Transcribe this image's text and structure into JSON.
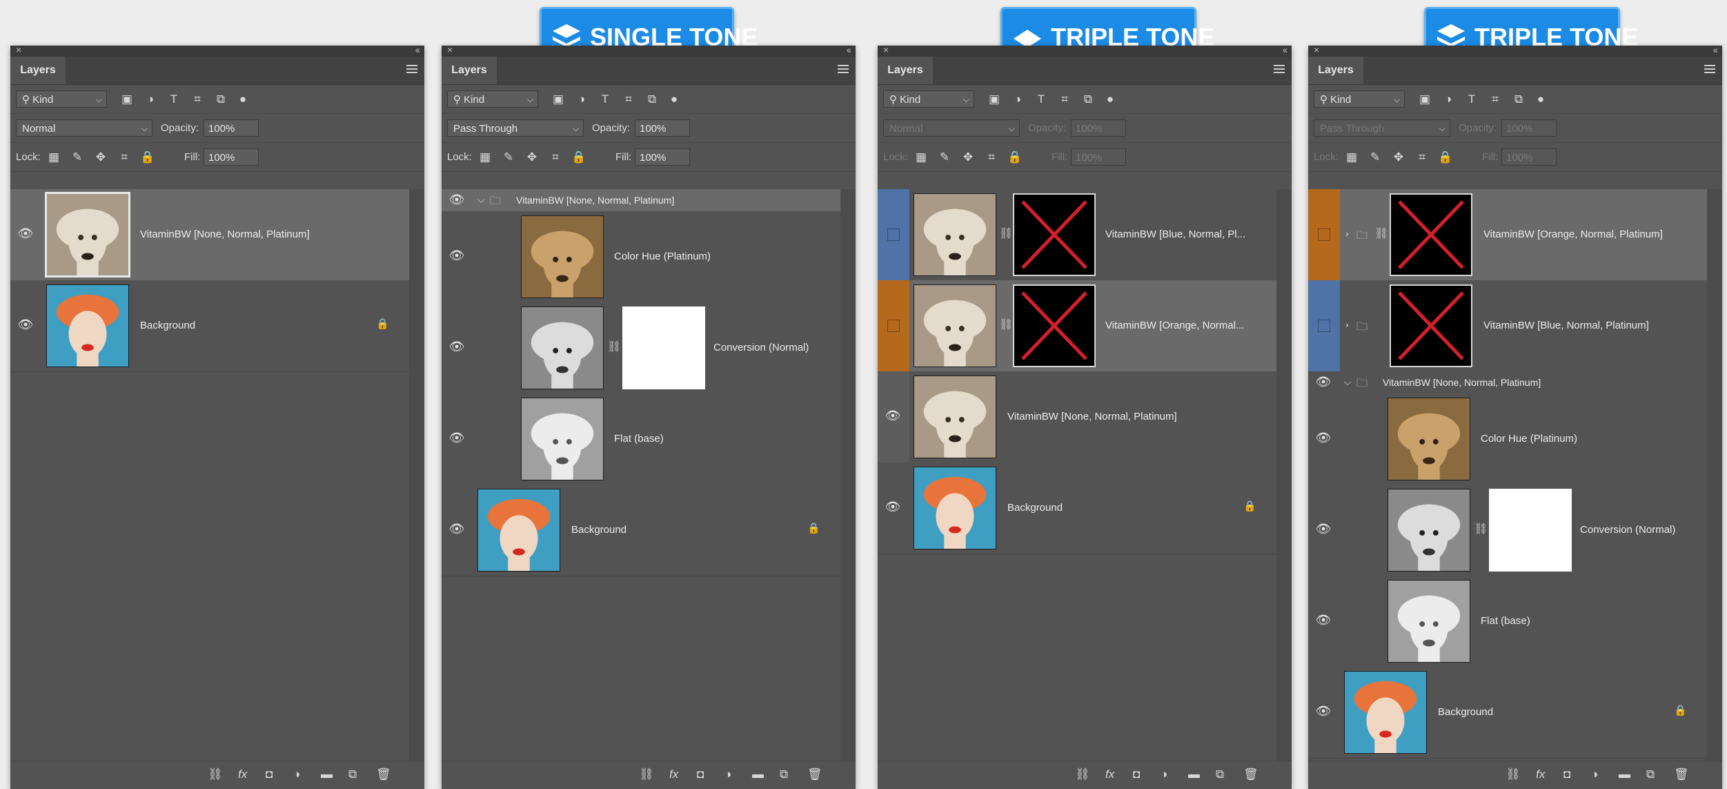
{
  "badges": [
    {
      "label": "SINGLE TONE",
      "icon": "layers-icon"
    },
    {
      "label": "TRIPLE TONE",
      "icon": "diamond-icon"
    },
    {
      "label": "TRIPLE TONE",
      "icon": "layers-icon"
    }
  ],
  "panel": {
    "close": "×",
    "collapse": "‹‹",
    "tab": "Layers",
    "kind": "Kind",
    "opacity_label": "Opacity:",
    "opacity_value": "100%",
    "lock_label": "Lock:",
    "fill_label": "Fill:",
    "fill_value": "100%"
  },
  "panel1": {
    "blend": "Normal",
    "layers": [
      "VitaminBW [None, Normal, Platinum]",
      "Background"
    ]
  },
  "panel2": {
    "blend": "Pass Through",
    "layers": [
      "VitaminBW [None, Normal, Platinum]",
      "Color Hue (Platinum)",
      "Conversion (Normal)",
      "Flat (base)",
      "Background"
    ]
  },
  "panel3": {
    "blend": "Normal",
    "layers": [
      "VitaminBW [Blue, Normal, Pl...",
      "VitaminBW [Orange, Normal...",
      "VitaminBW [None, Normal, Platinum]",
      "Background"
    ]
  },
  "panel4": {
    "blend": "Pass Through",
    "layers": [
      "VitaminBW [Orange, Normal, Platinum]",
      "VitaminBW [Blue, Normal, Platinum]",
      "VitaminBW [None, Normal, Platinum]",
      "Color Hue (Platinum)",
      "Conversion (Normal)",
      "Flat (base)",
      "Background"
    ]
  },
  "colors": {
    "orange": "#b5691d",
    "blue": "#4f73a6",
    "badge": "#1b8be6"
  }
}
